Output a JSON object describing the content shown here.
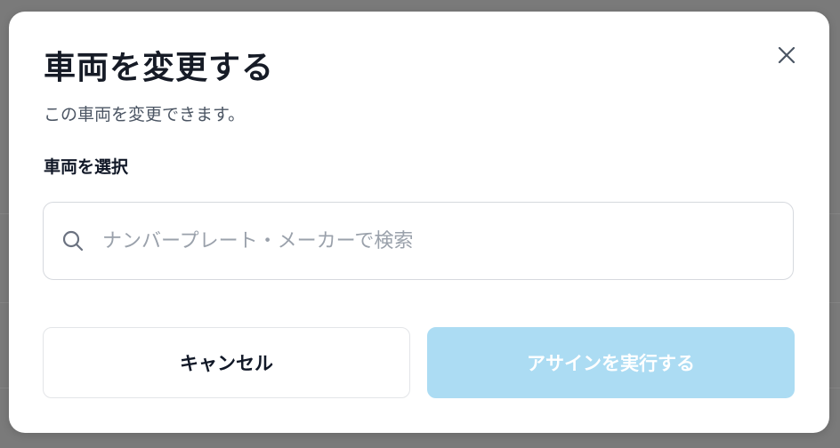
{
  "modal": {
    "title": "車両を変更する",
    "subtitle": "この車両を変更できます。",
    "close_icon": "close-icon"
  },
  "vehicle_select": {
    "label": "車両を選択",
    "placeholder": "ナンバープレート・メーカーで検索",
    "value": "",
    "icon": "search-icon"
  },
  "actions": {
    "cancel_label": "キャンセル",
    "assign_label": "アサインを実行する",
    "assign_disabled": true
  },
  "colors": {
    "overlay": "#7a7a7a",
    "primary_disabled": "#acdcf3",
    "title_text": "#161b26",
    "muted_text": "#4b5563",
    "placeholder_text": "#9aa1ab",
    "border": "#d6d9de"
  }
}
